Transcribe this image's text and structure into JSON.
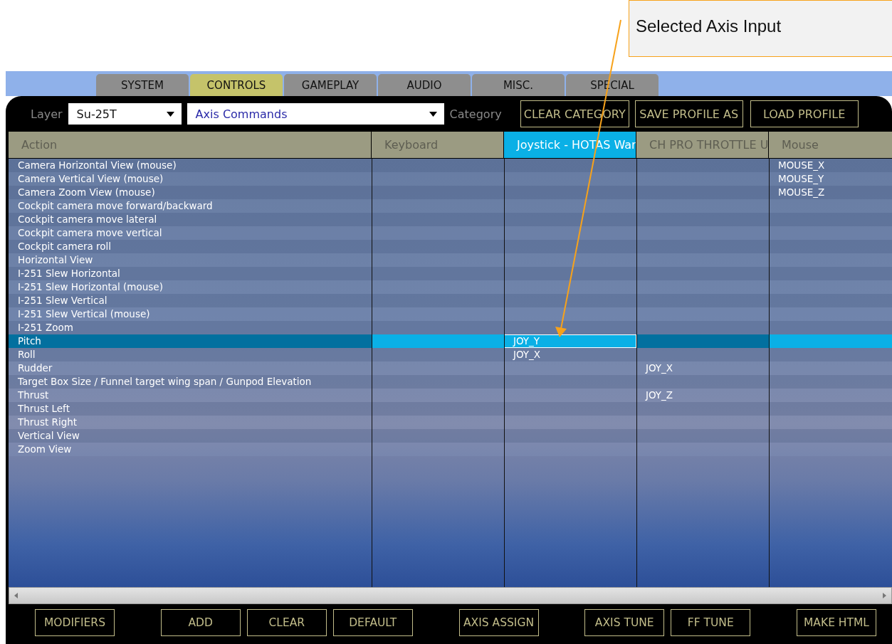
{
  "callout": {
    "text": "Selected Axis Input"
  },
  "tabs": [
    {
      "label": "SYSTEM",
      "selected": false
    },
    {
      "label": "CONTROLS",
      "selected": true
    },
    {
      "label": "GAMEPLAY",
      "selected": false
    },
    {
      "label": "AUDIO",
      "selected": false
    },
    {
      "label": "MISC.",
      "selected": false
    },
    {
      "label": "SPECIAL",
      "selected": false
    }
  ],
  "toolbar": {
    "layer_label": "Layer",
    "layer_value": "Su-25T",
    "category_value": "Axis Commands",
    "category_label": "Category",
    "buttons": [
      "CLEAR CATEGORY",
      "SAVE PROFILE AS",
      "LOAD PROFILE"
    ]
  },
  "columns": [
    {
      "label": "Action",
      "selected": false
    },
    {
      "label": "Keyboard",
      "selected": false
    },
    {
      "label": "Joystick - HOTAS War",
      "selected": true
    },
    {
      "label": "CH PRO THROTTLE U",
      "selected": false
    },
    {
      "label": "Mouse",
      "selected": false
    }
  ],
  "rows": [
    {
      "action": "Camera Horizontal View (mouse)",
      "mouse": "MOUSE_X",
      "selected": false
    },
    {
      "action": "Camera Vertical View (mouse)",
      "mouse": "MOUSE_Y",
      "selected": false
    },
    {
      "action": "Camera Zoom View (mouse)",
      "mouse": "MOUSE_Z",
      "selected": false
    },
    {
      "action": "Cockpit camera move forward/backward",
      "selected": false
    },
    {
      "action": "Cockpit camera move lateral",
      "selected": false
    },
    {
      "action": "Cockpit camera move vertical",
      "selected": false
    },
    {
      "action": "Cockpit camera roll",
      "selected": false
    },
    {
      "action": "Horizontal View",
      "selected": false
    },
    {
      "action": "I-251 Slew Horizontal",
      "selected": false
    },
    {
      "action": "I-251 Slew Horizontal (mouse)",
      "selected": false
    },
    {
      "action": "I-251 Slew Vertical",
      "selected": false
    },
    {
      "action": "I-251 Slew Vertical (mouse)",
      "selected": false
    },
    {
      "action": "I-251 Zoom",
      "selected": false
    },
    {
      "action": "Pitch",
      "joystick": "JOY_Y",
      "selected": true
    },
    {
      "action": "Roll",
      "joystick": "JOY_X",
      "selected": false
    },
    {
      "action": "Rudder",
      "throttle": "JOY_X",
      "selected": false
    },
    {
      "action": "Target Box Size / Funnel target wing span / Gunpod Elevation",
      "selected": false
    },
    {
      "action": "Thrust",
      "throttle": "JOY_Z",
      "selected": false
    },
    {
      "action": "Thrust Left",
      "selected": false
    },
    {
      "action": "Thrust Right",
      "selected": false
    },
    {
      "action": "Vertical View",
      "selected": false
    },
    {
      "action": "Zoom View",
      "selected": false
    }
  ],
  "bottom_buttons": [
    [
      "MODIFIERS"
    ],
    [
      "ADD",
      "CLEAR",
      "DEFAULT"
    ],
    [
      "AXIS ASSIGN"
    ],
    [
      "AXIS TUNE",
      "FF TUNE"
    ],
    [
      "MAKE HTML"
    ]
  ]
}
